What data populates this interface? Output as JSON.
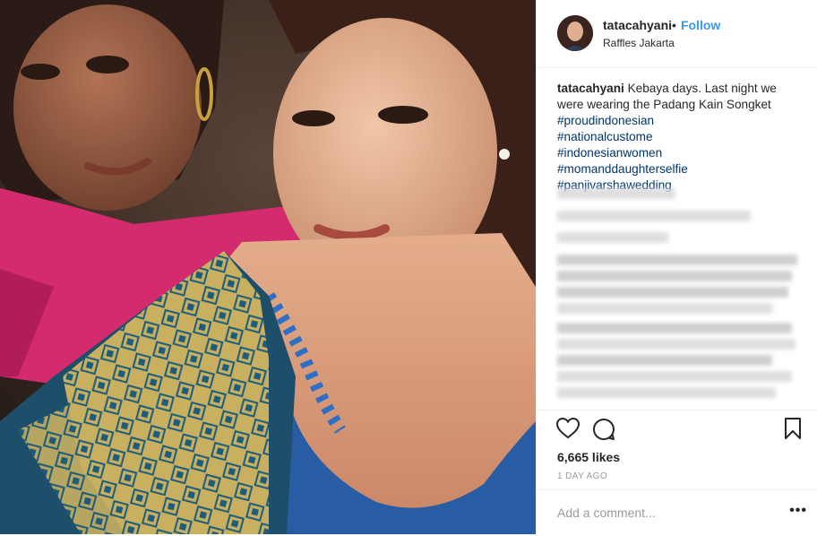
{
  "post": {
    "username": "tatacahyani",
    "separator": "•",
    "follow_label": "Follow",
    "location": "Raffles Jakarta"
  },
  "caption": {
    "username": "tatacahyani",
    "text": "Kebaya days. Last night we were wearing the Padang Kain Songket",
    "hashtags": [
      "#proudindonesian",
      "#nationalcustome",
      "#indonesianwomen",
      "#momanddaughterselfie",
      "#panjivarshawedding"
    ]
  },
  "actions": {
    "like_icon": "heart-icon",
    "comment_icon": "comment-icon",
    "save_icon": "bookmark-icon",
    "likes_text": "6,665 likes",
    "time_text": "1 DAY AGO"
  },
  "comment": {
    "placeholder": "Add a comment...",
    "more_label": "•••"
  },
  "colors": {
    "link_blue": "#3897f0",
    "hashtag": "#003569",
    "muted": "#999999",
    "text": "#262626",
    "divider": "#efefef"
  }
}
